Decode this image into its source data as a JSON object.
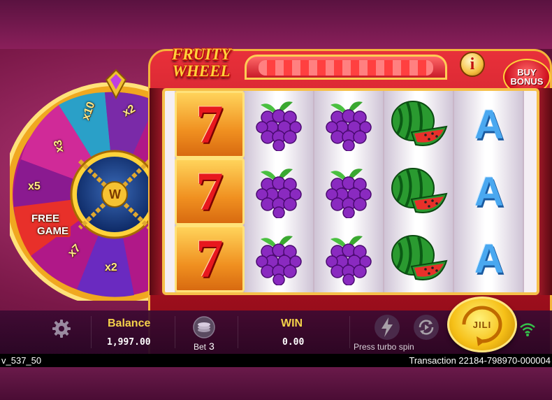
{
  "logo": {
    "line1": "FRUITY",
    "line2": "WHEEL"
  },
  "info_label": "i",
  "buy_bonus": {
    "line1": "BUY",
    "line2": "BONUS"
  },
  "wheel": {
    "segments": [
      "x10",
      "x2",
      "x3",
      "x5",
      "FREE",
      "GAME",
      "x7",
      "x2"
    ],
    "hub_label": "W"
  },
  "reels": [
    [
      "seven",
      "seven",
      "seven"
    ],
    [
      "grapes",
      "grapes",
      "grapes"
    ],
    [
      "grapes",
      "grapes",
      "grapes"
    ],
    [
      "watermelon",
      "watermelon",
      "watermelon"
    ],
    [
      "A",
      "A",
      "A"
    ]
  ],
  "seven_symbol": "7",
  "bottom_bar": {
    "settings_icon": "gear-icon",
    "balance_label": "Balance",
    "balance_value": "1,997.00",
    "bet_label": "Bet",
    "bet_value": "3",
    "win_label": "WIN",
    "win_value": "0.00",
    "turbo_icon": "lightning-icon",
    "turbo_hint": "Press turbo spin",
    "autoplay_icon": "autoplay-icon",
    "spin_icon": "spin-icon",
    "spin_label": "JILI",
    "signal_icon": "wifi-icon"
  },
  "footer": {
    "version": "v_537_50",
    "transaction": "Transaction 22184-798970-000004"
  },
  "colors": {
    "accent_gold": "#f4d24a",
    "frame_red": "#c81a28",
    "signal_green": "#35c24a"
  }
}
